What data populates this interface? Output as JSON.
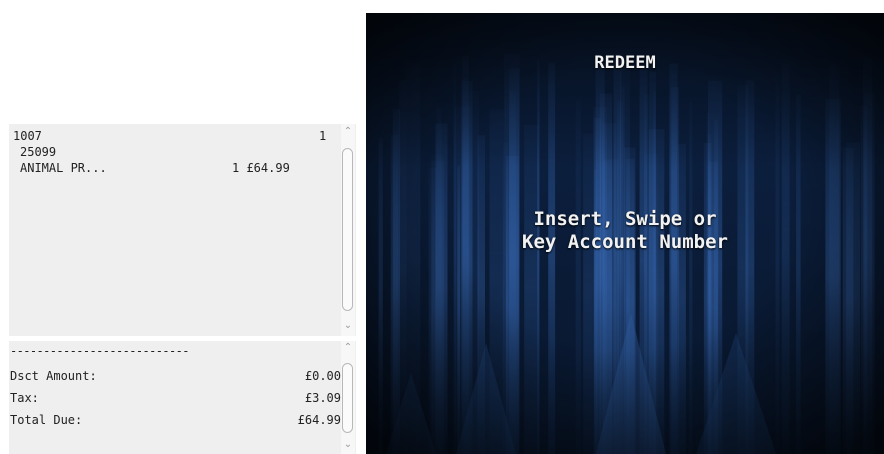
{
  "journal": {
    "header_left": "1007",
    "header_right": "1",
    "item_code": "25099",
    "item_desc": "ANIMAL PR...",
    "item_qty_price": "1 £64.99"
  },
  "totals": {
    "separator": "---------------------------",
    "rows": [
      {
        "label": "Dsct Amount:",
        "value": "£0.00"
      },
      {
        "label": "Tax:",
        "value": "£3.09"
      },
      {
        "label": "Total Due:",
        "value": "£64.99"
      }
    ]
  },
  "screen": {
    "title": "REDEEM",
    "prompt_line1": "Insert, Swipe or",
    "prompt_line2": "Key Account Number"
  },
  "colors": {
    "screen_background": "#071427",
    "screen_accent": "#2c5fa8",
    "panel_background": "#efefef"
  },
  "icons": {
    "scroll_up": "chevron-up-icon",
    "scroll_down": "chevron-down-icon"
  }
}
